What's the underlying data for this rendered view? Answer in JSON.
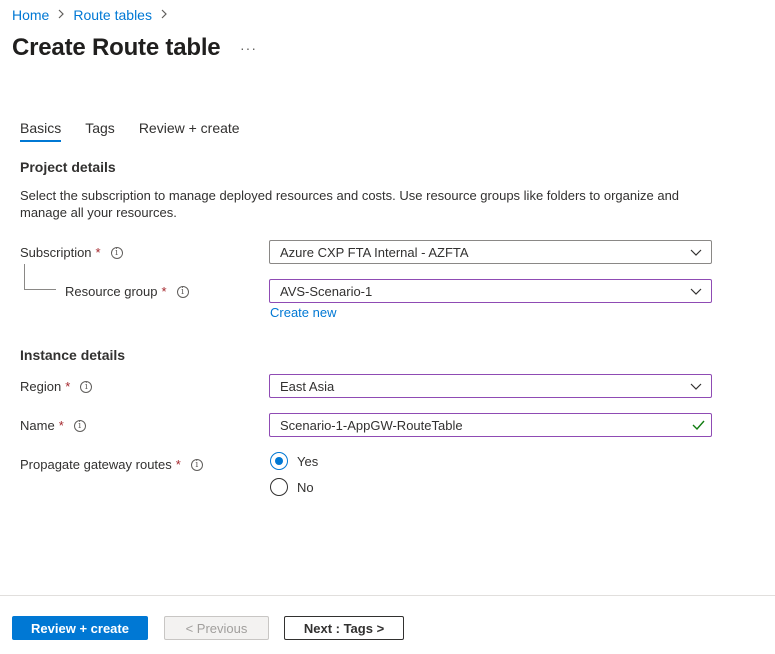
{
  "breadcrumb": {
    "home": "Home",
    "route_tables": "Route tables"
  },
  "page": {
    "title": "Create Route table",
    "more": "···"
  },
  "tabs": [
    {
      "label": "Basics",
      "active": true
    },
    {
      "label": "Tags",
      "active": false
    },
    {
      "label": "Review + create",
      "active": false
    }
  ],
  "project": {
    "title": "Project details",
    "description": "Select the subscription to manage deployed resources and costs. Use resource groups like folders to organize and manage all your resources.",
    "subscription_label": "Subscription",
    "subscription_value": "Azure CXP FTA Internal - AZFTA",
    "resource_group_label": "Resource group",
    "resource_group_value": "AVS-Scenario-1",
    "create_new": "Create new"
  },
  "instance": {
    "title": "Instance details",
    "region_label": "Region",
    "region_value": "East Asia",
    "name_label": "Name",
    "name_value": "Scenario-1-AppGW-RouteTable",
    "propagate_label": "Propagate gateway routes",
    "propagate_options": [
      {
        "label": "Yes",
        "selected": true
      },
      {
        "label": "No",
        "selected": false
      }
    ]
  },
  "required_mark": "*",
  "footer": {
    "review_create": "Review + create",
    "previous": "< Previous",
    "next": "Next : Tags >"
  },
  "colors": {
    "accent": "#0078d4",
    "focus_border": "#8f4bb4",
    "required": "#a4262c",
    "valid": "#107c10"
  }
}
